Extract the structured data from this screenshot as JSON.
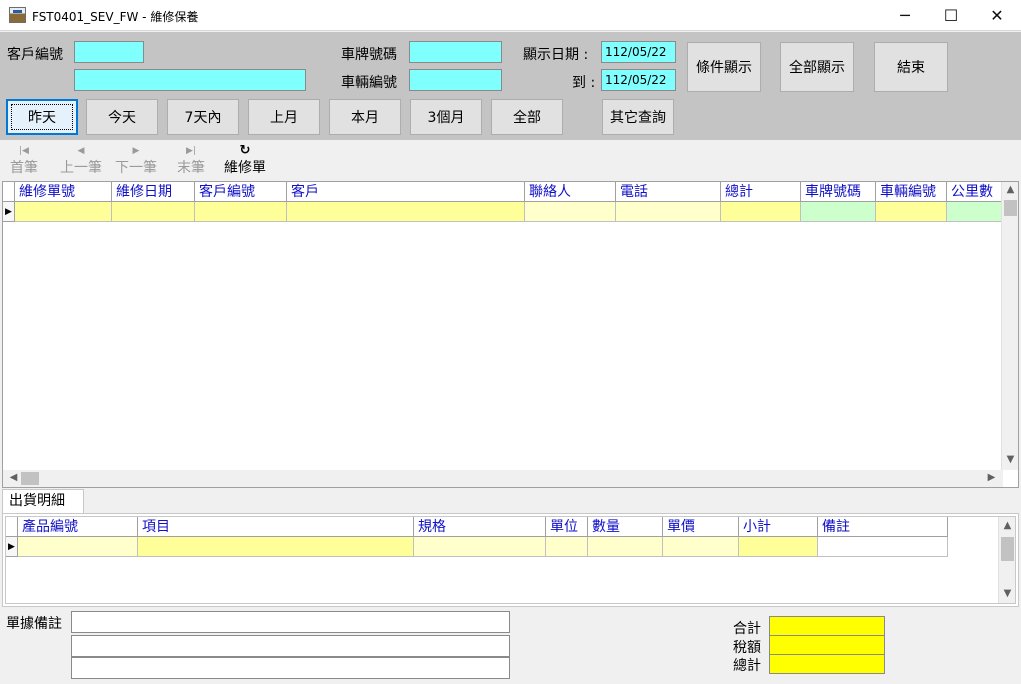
{
  "window": {
    "title": "FST0401_SEV_FW  - 維修保養",
    "minimize_glyph": "─",
    "maximize_glyph": "☐",
    "close_glyph": "✕"
  },
  "filters": {
    "customer_code_label": "客戶編號",
    "customer_code_value": "",
    "customer_name_value": "",
    "plate_label": "車牌號碼",
    "plate_value": "",
    "vehicle_no_label": "車輛編號",
    "vehicle_no_value": "",
    "date_from_label": "顯示日期 :",
    "date_from_value": "112/05/22",
    "date_to_label": "到 :",
    "date_to_value": "112/05/22"
  },
  "buttons": {
    "condition_display": "條件顯示",
    "show_all": "全部顯示",
    "exit": "結束",
    "yesterday": "昨天",
    "today": "今天",
    "last7": "7天內",
    "last_month": "上月",
    "this_month": "本月",
    "three_months": "3個月",
    "all": "全部",
    "other_query": "其它查詢"
  },
  "navigator": {
    "first": "首筆",
    "prev": "上一筆",
    "next": "下一筆",
    "last": "末筆",
    "refresh": "維修單",
    "first_icon": "skip-first-icon",
    "prev_icon": "prev-icon",
    "next_icon": "next-icon",
    "last_icon": "skip-last-icon",
    "refresh_icon": "refresh-icon"
  },
  "main_grid": {
    "columns": [
      "維修單號",
      "維修日期",
      "客戶編號",
      "客戶",
      "聯絡人",
      "電話",
      "總計",
      "車牌號碼",
      "車輛編號",
      "公里數"
    ]
  },
  "detail_tab": {
    "label": "出貨明細"
  },
  "detail_grid": {
    "columns": [
      "產品編號",
      "項目",
      "規格",
      "單位",
      "數量",
      "單價",
      "小計",
      "備註"
    ]
  },
  "footer": {
    "remark_label": "單據備註",
    "remark_1": "",
    "remark_2": "",
    "remark_3": "",
    "subtotal_label": "合計",
    "subtotal_value": "",
    "tax_label": "稅額",
    "tax_value": "",
    "total_label": "總計",
    "total_value": ""
  },
  "colors": {
    "input_cyan": "#80ffff",
    "header_text": "#1010c8",
    "total_yellow": "#ffff00"
  }
}
